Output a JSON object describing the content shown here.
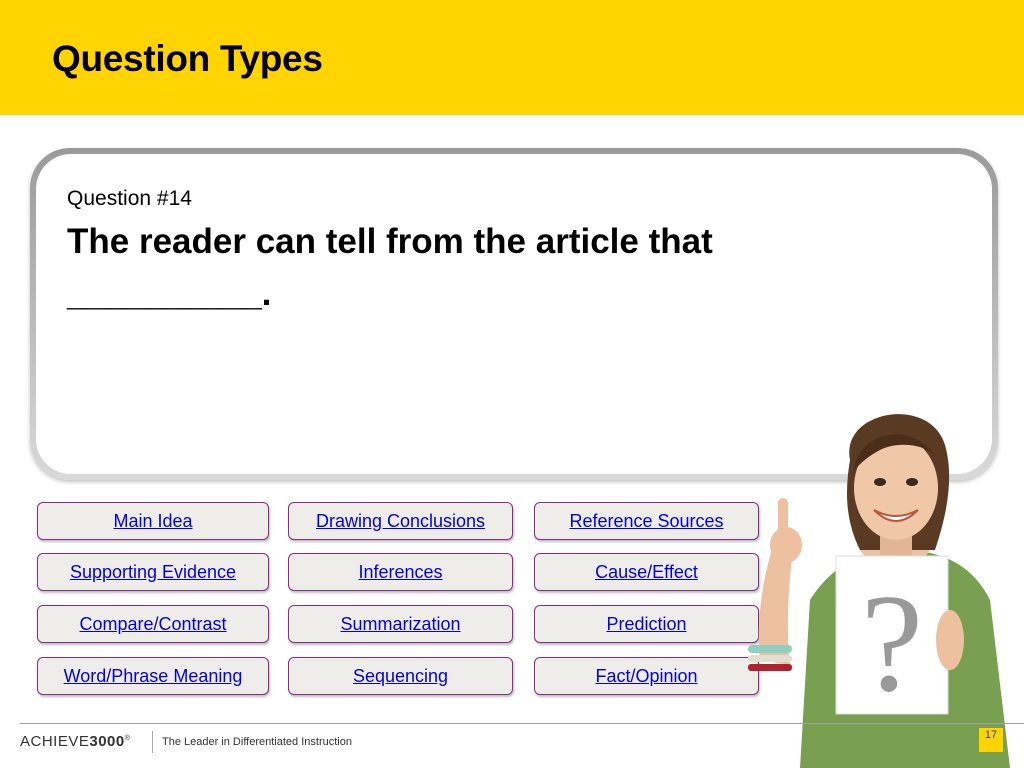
{
  "header": {
    "title": "Question Types"
  },
  "question": {
    "label": "Question #14",
    "text": "The reader can tell from the article that __________."
  },
  "buttons": [
    [
      "Main Idea",
      "Drawing Conclusions",
      "Reference Sources"
    ],
    [
      "Supporting Evidence",
      "Inferences",
      "Cause/Effect"
    ],
    [
      "Compare/Contrast",
      "Summarization",
      "Prediction"
    ],
    [
      "Word/Phrase Meaning",
      "Sequencing",
      "Fact/Opinion"
    ]
  ],
  "footer": {
    "logo_prefix": "ACHIEVE",
    "logo_number": "3000",
    "logo_mark": "®",
    "tagline": "The Leader in Differentiated Instruction",
    "page_number": "17"
  },
  "sign": {
    "glyph": "?"
  },
  "colors": {
    "header": "#ffd400",
    "button_border": "#8a2a8a",
    "link": "#0000ee"
  }
}
